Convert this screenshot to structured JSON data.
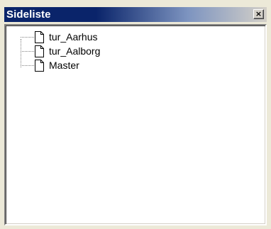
{
  "panel": {
    "title": "Sideliste",
    "close_label": "×"
  },
  "tree": {
    "items": [
      {
        "label": "tur_Aarhus",
        "icon": "document-icon"
      },
      {
        "label": "tur_Aalborg",
        "icon": "document-icon"
      },
      {
        "label": "Master",
        "icon": "document-icon"
      }
    ]
  }
}
